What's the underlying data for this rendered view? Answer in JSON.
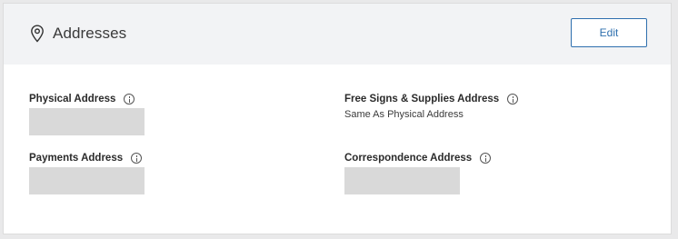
{
  "header": {
    "icon": "map-pin-icon",
    "title": "Addresses",
    "edit_label": "Edit"
  },
  "fields": {
    "physical": {
      "label": "Physical Address",
      "value": ""
    },
    "free_signs": {
      "label": "Free Signs & Supplies Address",
      "value": "Same As Physical Address"
    },
    "payments": {
      "label": "Payments Address",
      "value": ""
    },
    "correspondence": {
      "label": "Correspondence Address",
      "value": ""
    }
  },
  "colors": {
    "accent": "#2e6fae",
    "header_bg": "#f2f3f5",
    "redacted": "#d9d9d9"
  }
}
